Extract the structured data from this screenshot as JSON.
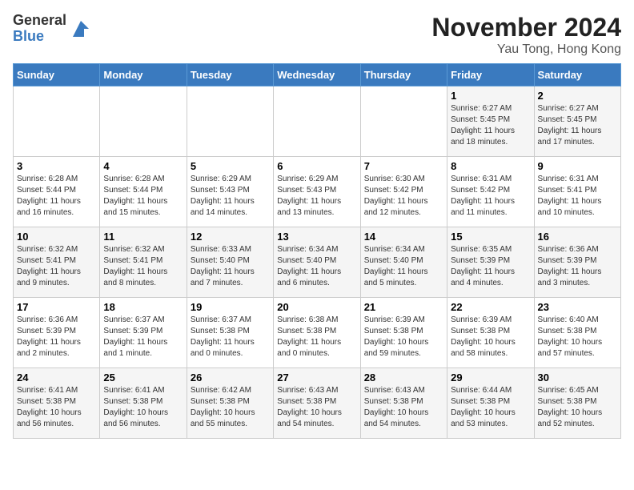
{
  "logo": {
    "general": "General",
    "blue": "Blue"
  },
  "title": "November 2024",
  "location": "Yau Tong, Hong Kong",
  "days_of_week": [
    "Sunday",
    "Monday",
    "Tuesday",
    "Wednesday",
    "Thursday",
    "Friday",
    "Saturday"
  ],
  "weeks": [
    [
      {
        "day": "",
        "info": ""
      },
      {
        "day": "",
        "info": ""
      },
      {
        "day": "",
        "info": ""
      },
      {
        "day": "",
        "info": ""
      },
      {
        "day": "",
        "info": ""
      },
      {
        "day": "1",
        "info": "Sunrise: 6:27 AM\nSunset: 5:45 PM\nDaylight: 11 hours\nand 18 minutes."
      },
      {
        "day": "2",
        "info": "Sunrise: 6:27 AM\nSunset: 5:45 PM\nDaylight: 11 hours\nand 17 minutes."
      }
    ],
    [
      {
        "day": "3",
        "info": "Sunrise: 6:28 AM\nSunset: 5:44 PM\nDaylight: 11 hours\nand 16 minutes."
      },
      {
        "day": "4",
        "info": "Sunrise: 6:28 AM\nSunset: 5:44 PM\nDaylight: 11 hours\nand 15 minutes."
      },
      {
        "day": "5",
        "info": "Sunrise: 6:29 AM\nSunset: 5:43 PM\nDaylight: 11 hours\nand 14 minutes."
      },
      {
        "day": "6",
        "info": "Sunrise: 6:29 AM\nSunset: 5:43 PM\nDaylight: 11 hours\nand 13 minutes."
      },
      {
        "day": "7",
        "info": "Sunrise: 6:30 AM\nSunset: 5:42 PM\nDaylight: 11 hours\nand 12 minutes."
      },
      {
        "day": "8",
        "info": "Sunrise: 6:31 AM\nSunset: 5:42 PM\nDaylight: 11 hours\nand 11 minutes."
      },
      {
        "day": "9",
        "info": "Sunrise: 6:31 AM\nSunset: 5:41 PM\nDaylight: 11 hours\nand 10 minutes."
      }
    ],
    [
      {
        "day": "10",
        "info": "Sunrise: 6:32 AM\nSunset: 5:41 PM\nDaylight: 11 hours\nand 9 minutes."
      },
      {
        "day": "11",
        "info": "Sunrise: 6:32 AM\nSunset: 5:41 PM\nDaylight: 11 hours\nand 8 minutes."
      },
      {
        "day": "12",
        "info": "Sunrise: 6:33 AM\nSunset: 5:40 PM\nDaylight: 11 hours\nand 7 minutes."
      },
      {
        "day": "13",
        "info": "Sunrise: 6:34 AM\nSunset: 5:40 PM\nDaylight: 11 hours\nand 6 minutes."
      },
      {
        "day": "14",
        "info": "Sunrise: 6:34 AM\nSunset: 5:40 PM\nDaylight: 11 hours\nand 5 minutes."
      },
      {
        "day": "15",
        "info": "Sunrise: 6:35 AM\nSunset: 5:39 PM\nDaylight: 11 hours\nand 4 minutes."
      },
      {
        "day": "16",
        "info": "Sunrise: 6:36 AM\nSunset: 5:39 PM\nDaylight: 11 hours\nand 3 minutes."
      }
    ],
    [
      {
        "day": "17",
        "info": "Sunrise: 6:36 AM\nSunset: 5:39 PM\nDaylight: 11 hours\nand 2 minutes."
      },
      {
        "day": "18",
        "info": "Sunrise: 6:37 AM\nSunset: 5:39 PM\nDaylight: 11 hours\nand 1 minute."
      },
      {
        "day": "19",
        "info": "Sunrise: 6:37 AM\nSunset: 5:38 PM\nDaylight: 11 hours\nand 0 minutes."
      },
      {
        "day": "20",
        "info": "Sunrise: 6:38 AM\nSunset: 5:38 PM\nDaylight: 11 hours\nand 0 minutes."
      },
      {
        "day": "21",
        "info": "Sunrise: 6:39 AM\nSunset: 5:38 PM\nDaylight: 10 hours\nand 59 minutes."
      },
      {
        "day": "22",
        "info": "Sunrise: 6:39 AM\nSunset: 5:38 PM\nDaylight: 10 hours\nand 58 minutes."
      },
      {
        "day": "23",
        "info": "Sunrise: 6:40 AM\nSunset: 5:38 PM\nDaylight: 10 hours\nand 57 minutes."
      }
    ],
    [
      {
        "day": "24",
        "info": "Sunrise: 6:41 AM\nSunset: 5:38 PM\nDaylight: 10 hours\nand 56 minutes."
      },
      {
        "day": "25",
        "info": "Sunrise: 6:41 AM\nSunset: 5:38 PM\nDaylight: 10 hours\nand 56 minutes."
      },
      {
        "day": "26",
        "info": "Sunrise: 6:42 AM\nSunset: 5:38 PM\nDaylight: 10 hours\nand 55 minutes."
      },
      {
        "day": "27",
        "info": "Sunrise: 6:43 AM\nSunset: 5:38 PM\nDaylight: 10 hours\nand 54 minutes."
      },
      {
        "day": "28",
        "info": "Sunrise: 6:43 AM\nSunset: 5:38 PM\nDaylight: 10 hours\nand 54 minutes."
      },
      {
        "day": "29",
        "info": "Sunrise: 6:44 AM\nSunset: 5:38 PM\nDaylight: 10 hours\nand 53 minutes."
      },
      {
        "day": "30",
        "info": "Sunrise: 6:45 AM\nSunset: 5:38 PM\nDaylight: 10 hours\nand 52 minutes."
      }
    ]
  ]
}
